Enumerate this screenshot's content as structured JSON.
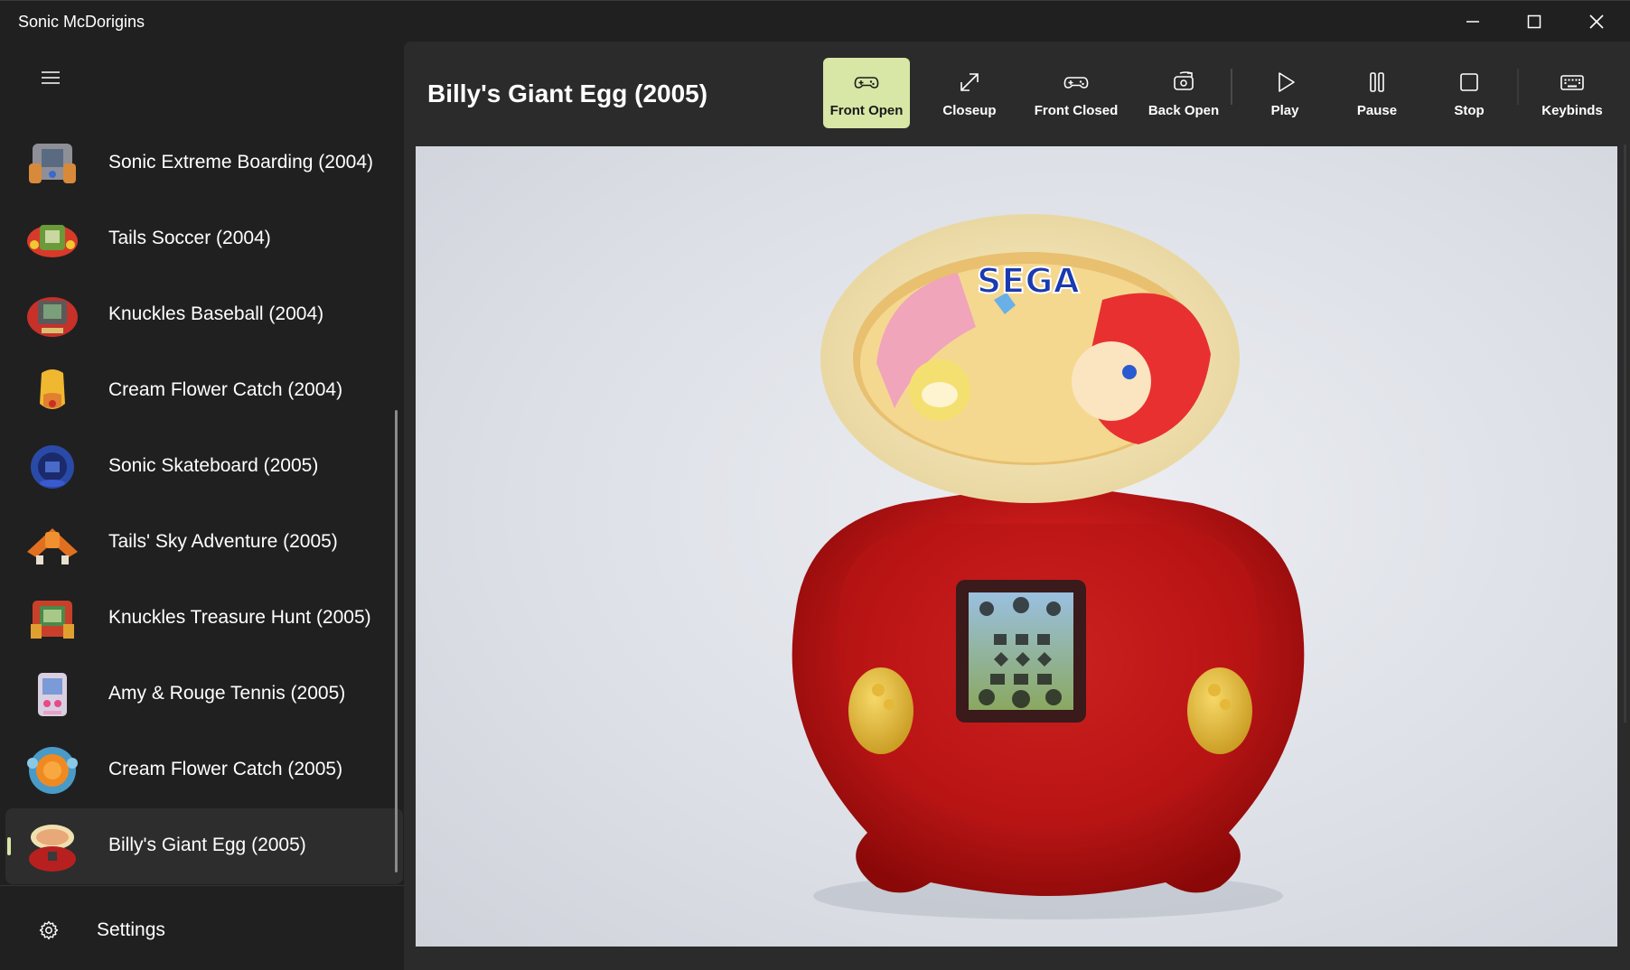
{
  "window": {
    "title": "Sonic McDorigins"
  },
  "sidebar": {
    "items": [
      {
        "label": "Sonic Extreme Boarding (2004)",
        "thumb": "handheld-grey-orange"
      },
      {
        "label": "Tails Soccer (2004)",
        "thumb": "handheld-green-red"
      },
      {
        "label": "Knuckles Baseball (2004)",
        "thumb": "handheld-red"
      },
      {
        "label": "Cream Flower Catch (2004)",
        "thumb": "handheld-yellow"
      },
      {
        "label": "Sonic Skateboard (2005)",
        "thumb": "handheld-blue"
      },
      {
        "label": "Tails' Sky Adventure (2005)",
        "thumb": "handheld-orange-plane"
      },
      {
        "label": "Knuckles Treasure Hunt (2005)",
        "thumb": "handheld-green-red-hunt"
      },
      {
        "label": "Amy & Rouge Tennis (2005)",
        "thumb": "handheld-pink"
      },
      {
        "label": "Cream Flower Catch (2005)",
        "thumb": "handheld-orange-flower"
      },
      {
        "label": "Billy's Giant Egg (2005)",
        "thumb": "handheld-red-egg",
        "selected": true
      }
    ],
    "settings_label": "Settings"
  },
  "main": {
    "title": "Billy's Giant Egg (2005)",
    "commands": [
      {
        "label": "Front Open",
        "icon": "gamepad-icon",
        "active": true
      },
      {
        "label": "Closeup",
        "icon": "expand-icon"
      },
      {
        "label": "Front Closed",
        "icon": "gamepad-icon"
      },
      {
        "label": "Back Open",
        "icon": "rotate-gamepad-icon"
      },
      {
        "label": "Play",
        "icon": "play-icon"
      },
      {
        "label": "Pause",
        "icon": "pause-icon"
      },
      {
        "label": "Stop",
        "icon": "stop-icon"
      },
      {
        "label": "Keybinds",
        "icon": "keyboard-icon"
      }
    ],
    "photo": {
      "logo_text": "SEGA"
    }
  },
  "colors": {
    "accent": "#d8e6a6",
    "background": "#202020",
    "content_bg": "#2b2b2b"
  }
}
